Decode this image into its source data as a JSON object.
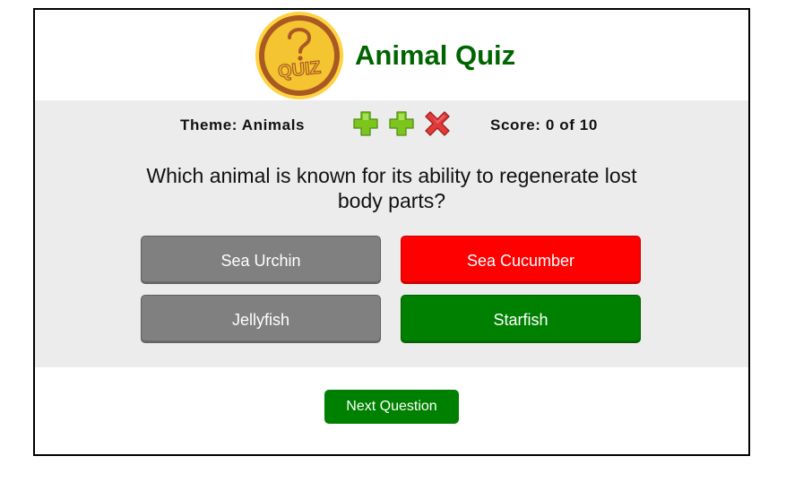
{
  "header": {
    "logo_text": "QUIZ",
    "title": "Animal Quiz"
  },
  "status": {
    "theme_label": "Theme: Animals",
    "score_label": "Score: 0 of 10",
    "indicators": [
      {
        "icon": "plus-icon",
        "color": "#7dc51e"
      },
      {
        "icon": "plus-icon",
        "color": "#7dc51e"
      },
      {
        "icon": "close-icon",
        "color": "#e03a3a"
      }
    ]
  },
  "question": {
    "text": "Which animal is known for its ability to regenerate lost body parts?"
  },
  "answers": [
    {
      "label": "Sea Urchin",
      "state": "neutral"
    },
    {
      "label": "Sea Cucumber",
      "state": "wrong"
    },
    {
      "label": "Jellyfish",
      "state": "neutral"
    },
    {
      "label": "Starfish",
      "state": "correct"
    }
  ],
  "actions": {
    "next_label": "Next Question"
  },
  "colors": {
    "title": "#006400",
    "panel": "#ececec",
    "neutral": "#808080",
    "wrong": "#ff0000",
    "correct": "#008000",
    "logo_gold": "#f5c431"
  }
}
